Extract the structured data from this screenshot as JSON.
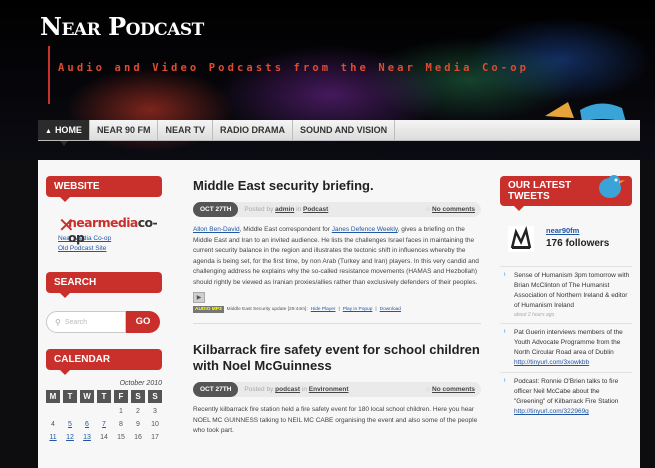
{
  "header": {
    "site_title": "Near Podcast",
    "tagline": "Audio and Video Podcasts from the Near Media Co-op"
  },
  "nav": {
    "items": [
      "HOME",
      "NEAR 90 FM",
      "NEAR TV",
      "RADIO DRAMA",
      "SOUND AND VISION"
    ]
  },
  "sidebar": {
    "website": {
      "title": "WEBSITE",
      "logo_part1": "near",
      "logo_part2": "media",
      "logo_part3": "co-op",
      "links": [
        "Near Media Co-op",
        "Old Podcast Site"
      ]
    },
    "search": {
      "title": "SEARCH",
      "placeholder": "Search",
      "button": "GO"
    },
    "calendar": {
      "title": "CALENDAR",
      "month": "October 2010",
      "days": [
        "M",
        "T",
        "W",
        "T",
        "F",
        "S",
        "S"
      ],
      "cells": [
        "",
        "",
        "",
        "",
        "1",
        "2",
        "3",
        "4",
        "5",
        "6",
        "7",
        "8",
        "9",
        "10",
        "11",
        "12",
        "13",
        "14",
        "15",
        "16",
        "17"
      ],
      "linked": [
        "5",
        "6",
        "7",
        "11",
        "12",
        "13"
      ]
    }
  },
  "posts": [
    {
      "title": "Middle East security briefing.",
      "date": "OCT 27TH",
      "posted_by": "Posted by",
      "author": "admin",
      "in": "in",
      "category": "Podcast",
      "comments": "No comments",
      "body_link1": "Allon Ben-David",
      "body_part1": ", Middle East correspondent for ",
      "body_link2": "Janes Defence Weekly",
      "body_part2": ", gives a briefing on the Middle East and Iran to an invited audience. He lists the challenges Israel faces in maintaining the current security balance in the region and illustrates the tectonic shift in influences whereby the agenda is being set, for the first time, by non Arab (Turkey and Iran) players. In this very candid and challenging address he explains why the so-called resistance movements (HAMAS and Hezbollah) should rightly be viewed as Iranian proxies/allies rather than exclusively defenders of their peoples.",
      "play_icon": "play-icon",
      "audio_badge": "AUDIO MP3",
      "audio_text": "Middle East Security update [29:44m]:",
      "audio_links": [
        "Hide Player",
        "Play in Popup",
        "Download"
      ]
    },
    {
      "title": "Kilbarrack fire safety event for school children with Noel McGuinness",
      "date": "OCT 27TH",
      "posted_by": "Posted by",
      "author": "podcast",
      "in": "in",
      "category": "Environment",
      "comments": "No comments",
      "body": "Recently kilbarrack fire station held a fire safety event for 180 local school children. Here you hear NOEL MC GUINNESS talking to NEIL MC CABE organising the event and also some of the people who took part."
    }
  ],
  "twitter": {
    "title_line1": "OUR LATEST",
    "title_line2": "TWEETS",
    "username": "near90fm",
    "followers": "176 followers",
    "tweets": [
      {
        "text": "Sense of Humanism 3pm tomorrow with Brian McClinton of The Humanist Association of Northern Ireland & editor of Humanism Ireland",
        "ago": "about 2 hours ago",
        "link": ""
      },
      {
        "text": "Pat Guerin interviews members of the Youth Advocate Programme from the North Circular Road area of Dublin",
        "ago": "",
        "link": "http://tinyurl.com/3xowkbb"
      },
      {
        "text": "Podcast: Ronnie O'Brien talks to fire officer Neil McCabe about the \"Greening\" of Kilbarrack Fire Station",
        "ago": "",
        "link": "http://tinyurl.com/322969g"
      }
    ]
  },
  "colors": {
    "accent": "#c9302c",
    "link": "#2156a5",
    "nav_active": "#2b2b2b"
  }
}
